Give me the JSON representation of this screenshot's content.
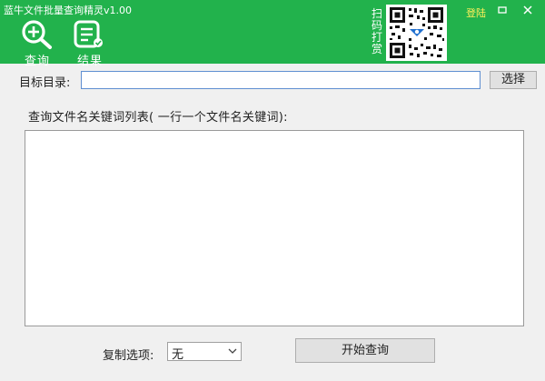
{
  "window": {
    "title": "蓝牛文件批量查询精灵v1.00",
    "minimize_icon": "minimize-icon",
    "close_icon": "close-icon"
  },
  "toolbar": {
    "query_label": "查询",
    "result_label": "结果",
    "query_icon": "magnifier-plus-icon",
    "result_icon": "document-list-icon",
    "reward_text": "扫码打赏",
    "qr_icon": "qr-code",
    "login_label": "登陆"
  },
  "form": {
    "dir_label": "目标目录:",
    "dir_value": "",
    "select_button": "选择",
    "keywords_label": "查询文件名关键词列表( 一行一个文件名关键词):",
    "keywords_value": "",
    "copy_label": "复制选项:",
    "copy_selected": "无",
    "start_button": "开始查询"
  },
  "colors": {
    "header_bg": "#22b24c",
    "login_text": "#fff15a",
    "input_border": "#5f8fd1"
  }
}
